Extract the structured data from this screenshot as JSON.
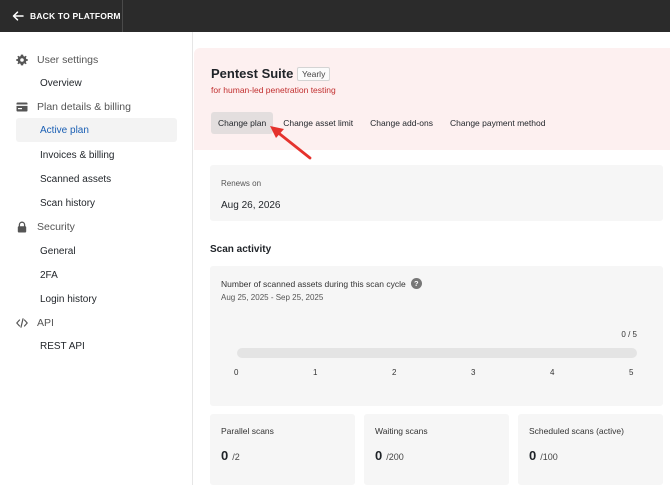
{
  "topbar": {
    "back_label": "BACK TO PLATFORM"
  },
  "sidebar": {
    "groups": [
      {
        "label": "User settings",
        "icon": "gear-icon"
      },
      {
        "label": "Plan details & billing",
        "icon": "billing-icon"
      },
      {
        "label": "Security",
        "icon": "lock-icon"
      },
      {
        "label": "API",
        "icon": "code-icon"
      }
    ],
    "items": [
      {
        "label": "Overview"
      },
      {
        "label": "Active plan",
        "active": true
      },
      {
        "label": "Invoices & billing"
      },
      {
        "label": "Scanned assets"
      },
      {
        "label": "Scan history"
      },
      {
        "label": "General"
      },
      {
        "label": "2FA"
      },
      {
        "label": "Login history"
      },
      {
        "label": "REST API"
      }
    ],
    "active_color": "#1a5fb4"
  },
  "plan": {
    "name": "Pentest Suite",
    "badge": "Yearly",
    "subtitle": "for human-led penetration testing",
    "actions": [
      "Change plan",
      "Change asset limit",
      "Change add-ons",
      "Change payment method"
    ],
    "accent_color": "#c12e2e",
    "background_color": "#fdf0f0"
  },
  "renewal": {
    "label": "Renews on",
    "date": "Aug 26, 2026"
  },
  "activity": {
    "section_title": "Scan activity",
    "title": "Number of scanned assets during this scan cycle",
    "range": "Aug 25, 2025 - Sep 25, 2025",
    "usage_label": "0 / 5",
    "used": 0,
    "limit": 5,
    "ticks": [
      "0",
      "1",
      "2",
      "3",
      "4",
      "5"
    ]
  },
  "stats": [
    {
      "label": "Parallel scans",
      "value": "0",
      "total": "/2"
    },
    {
      "label": "Waiting scans",
      "value": "0",
      "total": "/200"
    },
    {
      "label": "Scheduled scans (active)",
      "value": "0",
      "total": "/100"
    }
  ]
}
